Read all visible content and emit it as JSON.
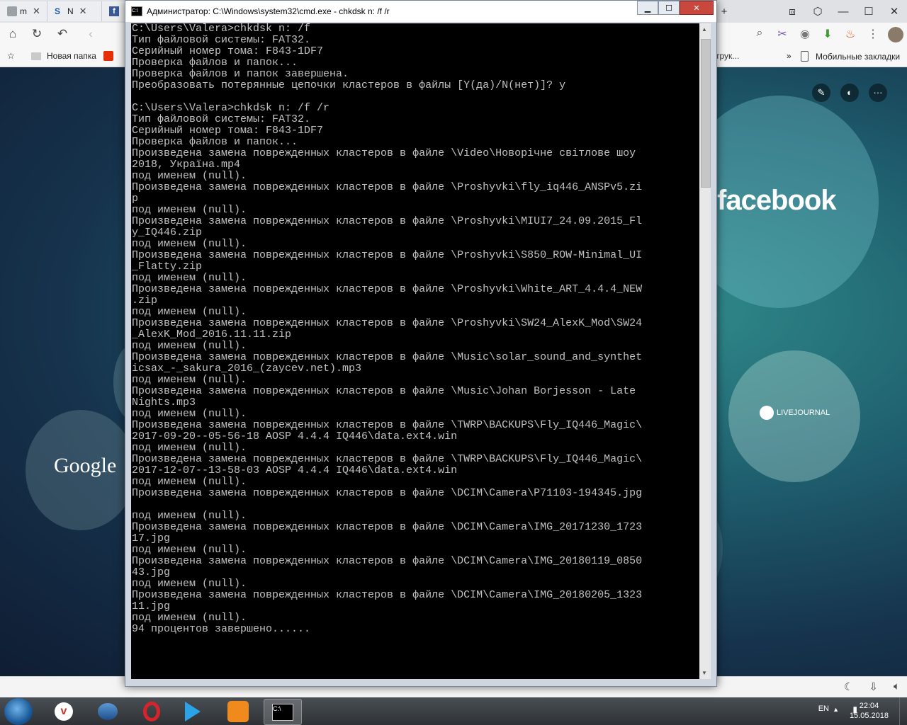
{
  "browser": {
    "tabs": [
      {
        "label": "m",
        "icon": "document-icon"
      },
      {
        "label": "N",
        "icon": "sj-icon"
      },
      {
        "label": "F",
        "icon": "facebook-icon"
      }
    ],
    "bookmarks": {
      "folder_label": "Новая папка",
      "partial_label": "трук...",
      "more_label": "»",
      "mobile_label": "Мобильные закладки"
    }
  },
  "newtab": {
    "sites": [
      {
        "name": "facebook"
      },
      {
        "name": "LIVEJOURNAL"
      },
      {
        "name": "Google"
      }
    ]
  },
  "cmd": {
    "title": "Администратор: C:\\Windows\\system32\\cmd.exe - chkdsk  n: /f /r",
    "lines": [
      "C:\\Users\\Valera>chkdsk n: /f",
      "Тип файловой системы: FAT32.",
      "Серийный номер тома: F843-1DF7",
      "Проверка файлов и папок...",
      "Проверка файлов и папок завершена.",
      "Преобразовать потерянные цепочки кластеров в файлы [Y(да)/N(нет)]? y",
      "",
      "C:\\Users\\Valera>chkdsk n: /f /r",
      "Тип файловой системы: FAT32.",
      "Серийный номер тома: F843-1DF7",
      "Проверка файлов и папок...",
      "Произведена замена поврежденных кластеров в файле \\Video\\Новорічне світлове шоу",
      "2018, Україна.mp4",
      "под именем (null).",
      "Произведена замена поврежденных кластеров в файле \\Proshyvki\\fly_iq446_ANSPv5.zi",
      "p",
      "под именем (null).",
      "Произведена замена поврежденных кластеров в файле \\Proshyvki\\MIUI7_24.09.2015_Fl",
      "y_IQ446.zip",
      "под именем (null).",
      "Произведена замена поврежденных кластеров в файле \\Proshyvki\\S850_ROW-Minimal_UI",
      "_Flatty.zip",
      "под именем (null).",
      "Произведена замена поврежденных кластеров в файле \\Proshyvki\\White_ART_4.4.4_NEW",
      ".zip",
      "под именем (null).",
      "Произведена замена поврежденных кластеров в файле \\Proshyvki\\SW24_AlexK_Mod\\SW24",
      "_AlexK_Mod_2016.11.11.zip",
      "под именем (null).",
      "Произведена замена поврежденных кластеров в файле \\Music\\solar_sound_and_synthet",
      "icsax_-_sakura_2016_(zaycev.net).mp3",
      "под именем (null).",
      "Произведена замена поврежденных кластеров в файле \\Music\\Johan Borjesson - Late",
      "Nights.mp3",
      "под именем (null).",
      "Произведена замена поврежденных кластеров в файле \\TWRP\\BACKUPS\\Fly_IQ446_Magic\\",
      "2017-09-20--05-56-18 AOSP 4.4.4 IQ446\\data.ext4.win",
      "под именем (null).",
      "Произведена замена поврежденных кластеров в файле \\TWRP\\BACKUPS\\Fly_IQ446_Magic\\",
      "2017-12-07--13-58-03 AOSP 4.4.4 IQ446\\data.ext4.win",
      "под именем (null).",
      "Произведена замена поврежденных кластеров в файле \\DCIM\\Camera\\P71103-194345.jpg",
      "",
      "под именем (null).",
      "Произведена замена поврежденных кластеров в файле \\DCIM\\Camera\\IMG_20171230_1723",
      "17.jpg",
      "под именем (null).",
      "Произведена замена поврежденных кластеров в файле \\DCIM\\Camera\\IMG_20180119_0850",
      "43.jpg",
      "под именем (null).",
      "Произведена замена поврежденных кластеров в файле \\DCIM\\Camera\\IMG_20180205_1323",
      "11.jpg",
      "под именем (null).",
      "94 процентов завершено......"
    ]
  },
  "taskbar": {
    "apps": [
      "vivaldi-icon",
      "thunderbird-icon",
      "opera-icon",
      "media-player-icon",
      "uc-browser-icon",
      "cmd-icon"
    ],
    "language": "EN",
    "time": "22:04",
    "date": "15.05.2018"
  }
}
